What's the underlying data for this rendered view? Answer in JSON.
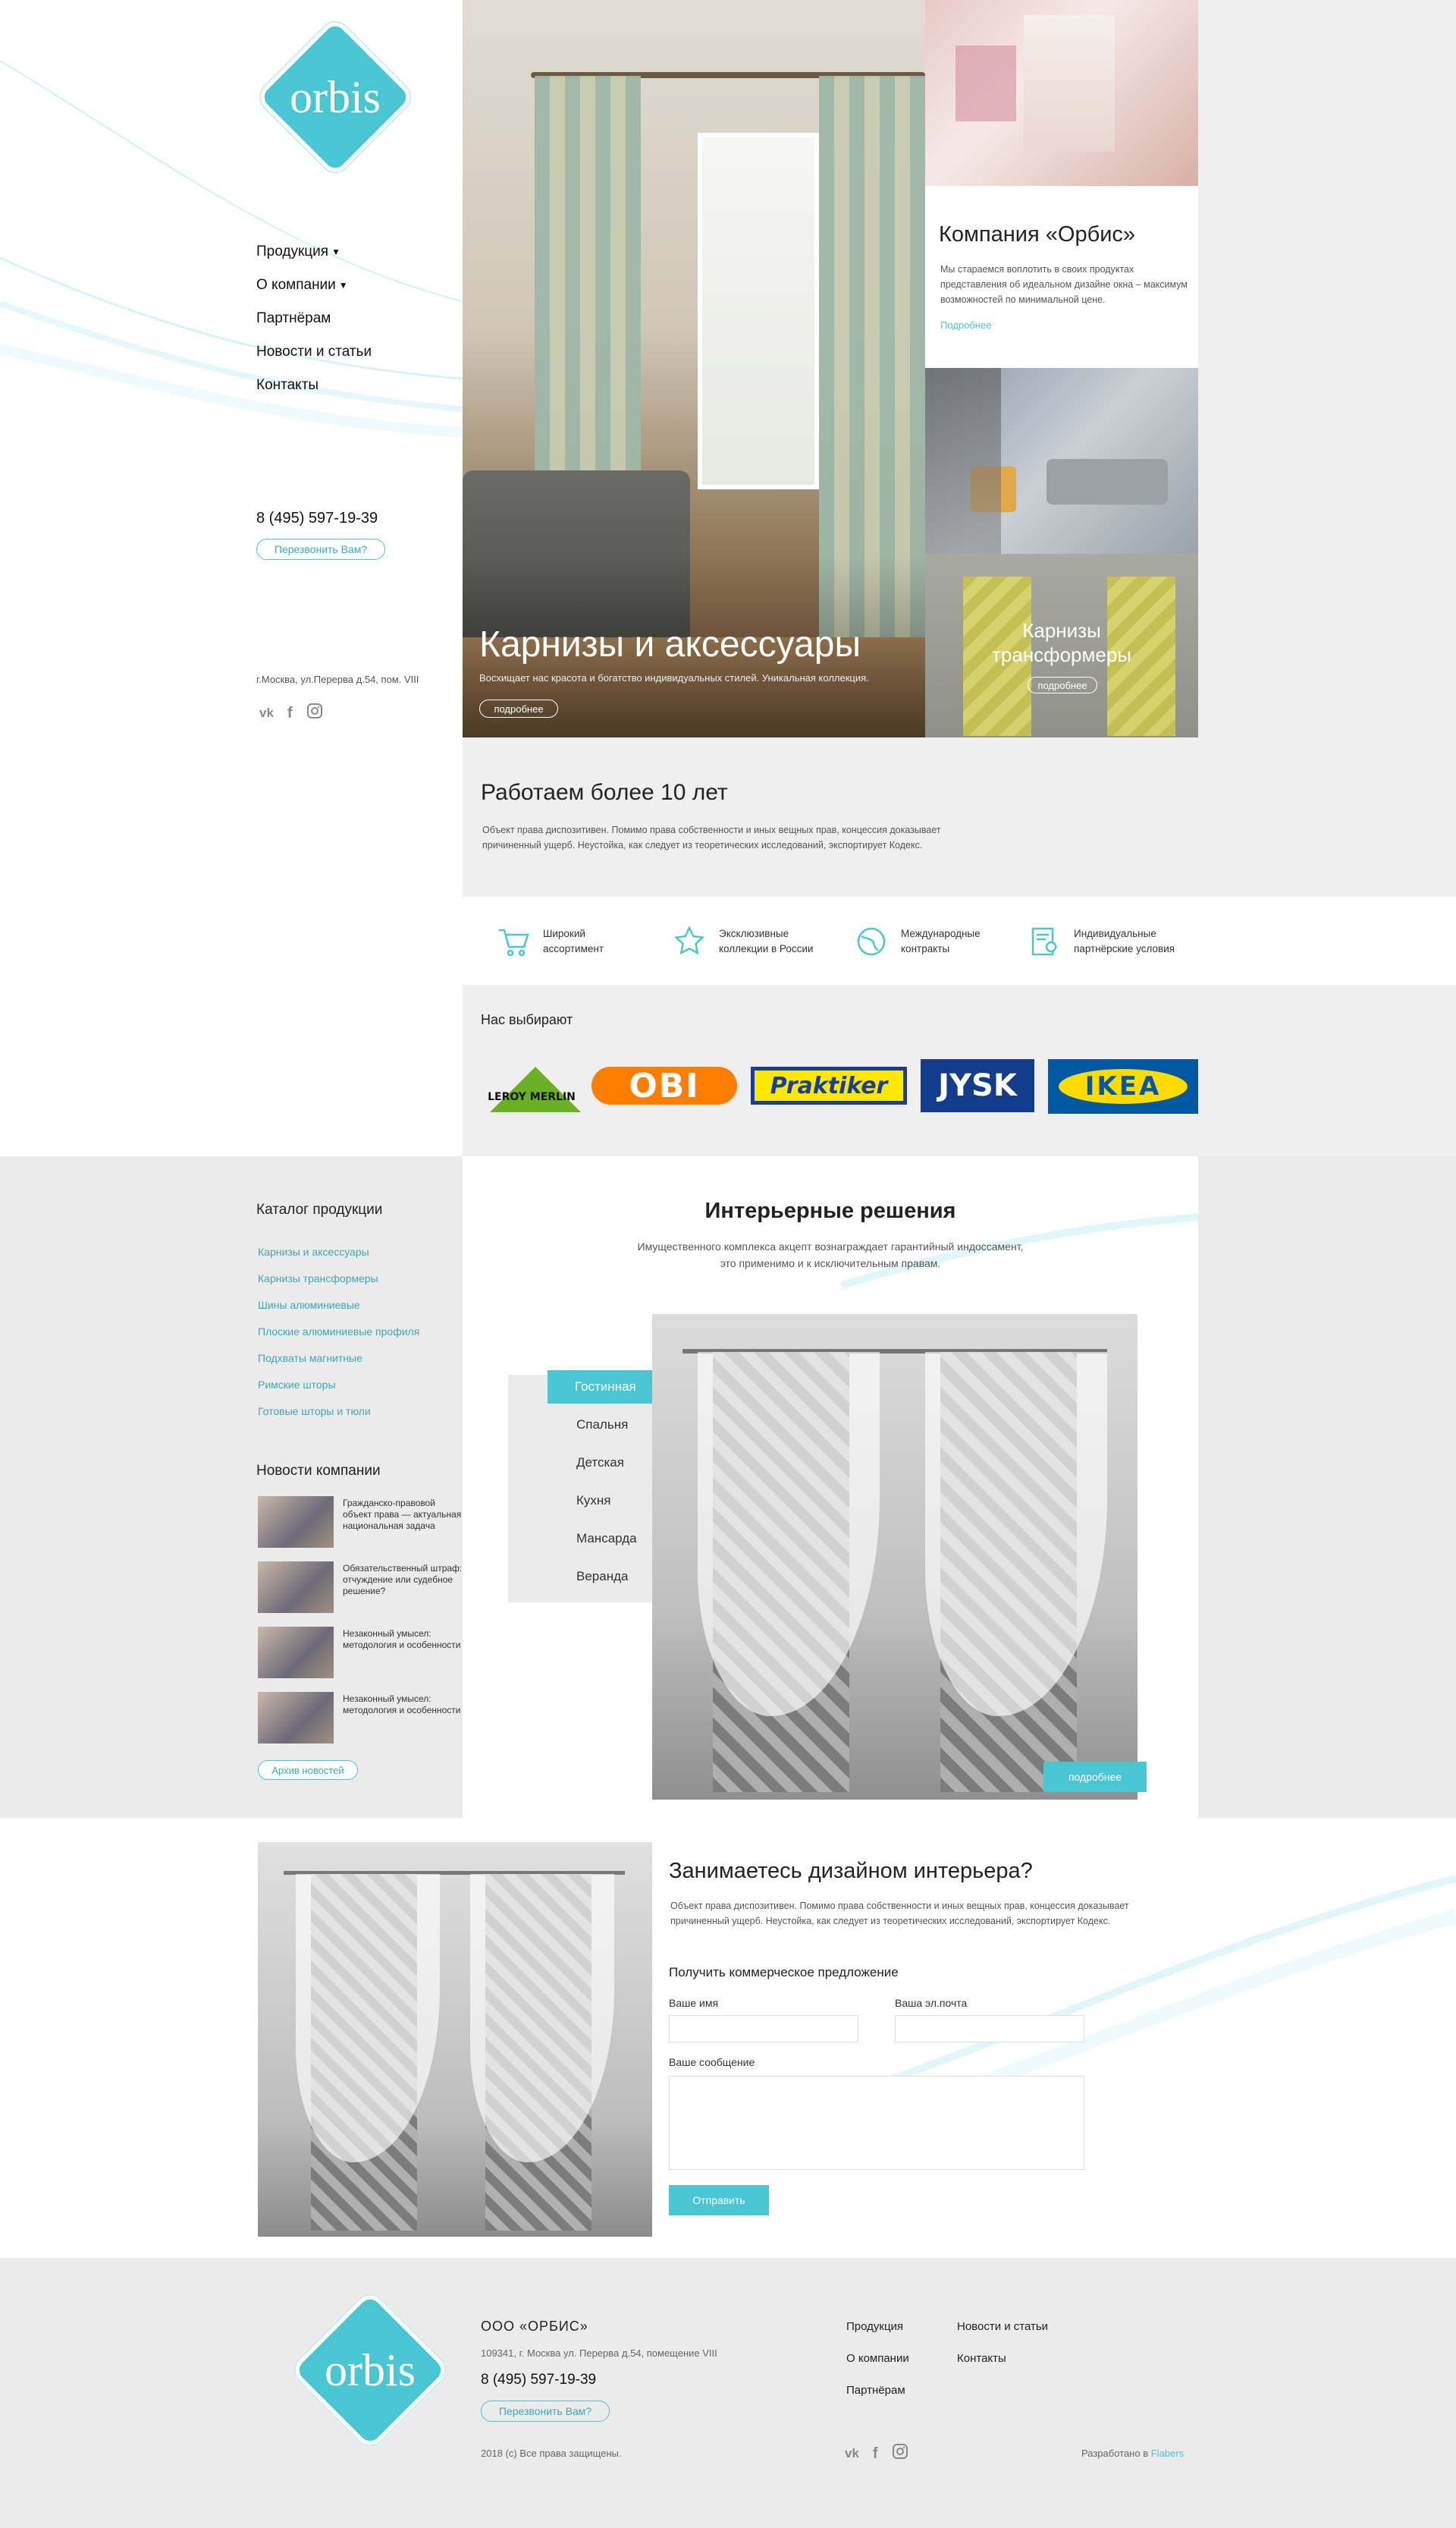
{
  "brand": {
    "logo_text": "orbis",
    "accent": "#4ac6d2"
  },
  "nav": [
    {
      "label": "Продукция",
      "has_caret": true
    },
    {
      "label": "О компании",
      "has_caret": true
    },
    {
      "label": "Партнёрам"
    },
    {
      "label": "Новости и статьи"
    },
    {
      "label": "Контакты"
    }
  ],
  "sidebar": {
    "phone": "8 (495) 597-19-39",
    "callback": "Перезвонить Вам?",
    "address": "г.Москва, ул.Перерва д.54, пом. VIII",
    "socials": [
      "vk-icon",
      "facebook-icon",
      "instagram-icon"
    ]
  },
  "hero": {
    "title": "Карнизы и аксессуары",
    "subtitle": "Восхищает нас красота и богатство индивидуальных стилей. Уникальная коллекция.",
    "more": "подробнее"
  },
  "company": {
    "title": "Компания «Орбис»",
    "text": "Мы стараемся воплотить в своих продуктах представления об идеальном дизайне окна – максимум возможностей по минимальной цене.",
    "more": "Подробнее"
  },
  "transformers": {
    "title_line1": "Карнизы",
    "title_line2": "трансформеры",
    "more": "подробнее"
  },
  "about": {
    "title": "Работаем более 10 лет",
    "text": "Объект права диспозитивен. Помимо права собственности и иных вещных прав, концессия доказывает причиненный ущерб. Неустойка, как следует из теоретических исследований, экспортирует Кодекс."
  },
  "features": [
    {
      "icon": "cart-icon",
      "line1": "Широкий",
      "line2": "ассортимент"
    },
    {
      "icon": "star-icon",
      "line1": "Эксклюзивные",
      "line2": "коллекции в России"
    },
    {
      "icon": "globe-icon",
      "line1": "Международные",
      "line2": "контракты"
    },
    {
      "icon": "certificate-icon",
      "line1": "Индивидуальные",
      "line2": "партнёрские условия"
    }
  ],
  "brands": {
    "title": "Нас выбирают",
    "items": [
      "LEROY MERLIN",
      "OBI",
      "Praktiker",
      "JYSK",
      "IKEA"
    ]
  },
  "catalog": {
    "title": "Каталог продукции",
    "items": [
      "Карнизы и аксессуары",
      "Карнизы трансформеры",
      "Шины алюминиевые",
      "Плоские алюминиевые профиля",
      "Подхваты магнитные",
      "Римские шторы",
      "Готовые шторы и тюли"
    ]
  },
  "news": {
    "title": "Новости компании",
    "items": [
      "Гражданско-правовой объект права — актуальная национальная задача",
      "Обязательственный штраф: отчуждение или судебное решение?",
      "Незаконный умысел: методология и особенности",
      "Незаконный умысел: методология и особенности"
    ],
    "archive": "Архив новостей"
  },
  "interior": {
    "title": "Интерьерные решения",
    "text_line1": "Имущественного комплекса акцепт вознаграждает гарантийный индоссамент,",
    "text_line2": "это применимо и к исключительным правам.",
    "tabs": [
      "Гостинная",
      "Спальня",
      "Детская",
      "Кухня",
      "Мансарда",
      "Веранда"
    ],
    "active_tab": 0,
    "more": "подробнее"
  },
  "design": {
    "title": "Занимаетесь дизайном интерьера?",
    "text": "Объект права диспозитивен. Помимо права собственности и иных вещных прав, концессия доказывает причиненный ущерб. Неустойка, как следует из теоретических исследований, экспортирует Кодекс.",
    "form_title": "Получить коммерческое предложение",
    "name_label": "Ваше имя",
    "email_label": "Ваша эл.почта",
    "message_label": "Ваше сообщение",
    "submit": "Отправить"
  },
  "footer": {
    "company": "ООО «ОРБИС»",
    "address": "109341, г. Москва ул. Перерва д.54, помещение VIII",
    "phone": "8 (495) 597-19-39",
    "callback": "Перезвонить Вам?",
    "copyright": "2018 (с) Все права защищены.",
    "links": [
      "Продукция",
      "Новости и статьи",
      "О компании",
      "Контакты",
      "Партнёрам"
    ],
    "developed_prefix": "Разработано в",
    "developer": "Flabers"
  }
}
